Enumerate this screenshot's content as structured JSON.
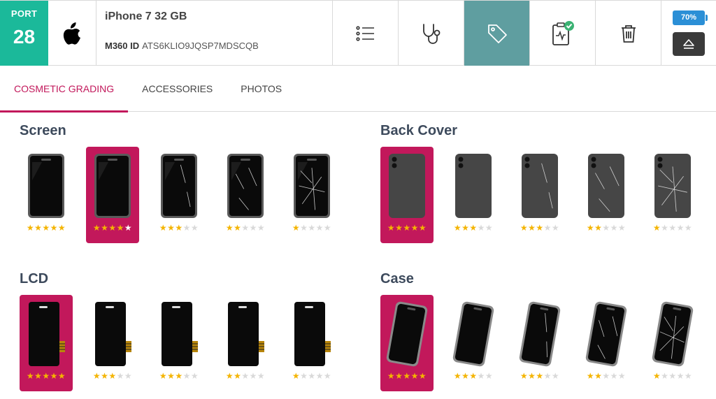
{
  "header": {
    "port_label": "PORT",
    "port_number": "28",
    "brand_icon": "apple-logo-icon",
    "device_name": "iPhone 7 32 GB",
    "id_label": "M360 ID",
    "id_value": "ATS6KLIO9JQSP7MDSCQB",
    "tools": [
      {
        "icon": "list-icon",
        "active": false
      },
      {
        "icon": "stethoscope-icon",
        "active": false
      },
      {
        "icon": "tag-icon",
        "active": true
      },
      {
        "icon": "report-check-icon",
        "active": false
      },
      {
        "icon": "trash-icon",
        "active": false
      }
    ],
    "battery": "70%",
    "eject_icon": "eject-icon"
  },
  "tabs": [
    {
      "label": "COSMETIC GRADING",
      "active": true
    },
    {
      "label": "ACCESSORIES",
      "active": false
    },
    {
      "label": "PHOTOS",
      "active": false
    }
  ],
  "sections": [
    {
      "key": "screen",
      "title": "Screen",
      "kind": "front",
      "selected_index": 1,
      "ratings": [
        5,
        4,
        3,
        2,
        1
      ]
    },
    {
      "key": "back_cover",
      "title": "Back Cover",
      "kind": "back",
      "selected_index": 0,
      "ratings": [
        5,
        3,
        3,
        2,
        1
      ]
    },
    {
      "key": "lcd",
      "title": "LCD",
      "kind": "lcd",
      "selected_index": 0,
      "ratings": [
        5,
        3,
        3,
        2,
        1
      ]
    },
    {
      "key": "case",
      "title": "Case",
      "kind": "case",
      "selected_index": 0,
      "ratings": [
        5,
        3,
        3,
        2,
        1
      ]
    }
  ],
  "colors": {
    "accent": "#c2185b",
    "port_bg": "#1bb99a",
    "active_tool_bg": "#5f9ea0",
    "battery": "#2b8fd6",
    "star": "#f4b400"
  }
}
